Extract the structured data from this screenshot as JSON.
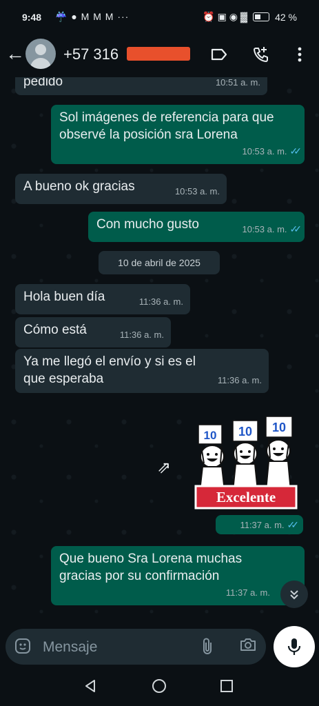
{
  "status": {
    "time": "9:48",
    "notifications": "☔ ● M M M ···",
    "icons": "⏰ ▣ ◉ ▓",
    "battery": "42 %"
  },
  "header": {
    "title": "+57 316",
    "back_icon": "←"
  },
  "messages": [
    {
      "dir": "in",
      "text": "pedido",
      "time": "10:51 a. m."
    },
    {
      "dir": "out",
      "text": "Sol imágenes de referencia para que observé la posición sra Lorena",
      "time": "10:53 a. m."
    },
    {
      "dir": "in",
      "text": "A bueno ok gracias",
      "time": "10:53 a. m."
    },
    {
      "dir": "out",
      "text": "Con mucho gusto",
      "time": "10:53 a. m."
    },
    {
      "dir": "in",
      "text": "Hola buen día",
      "time": "11:36 a. m."
    },
    {
      "dir": "in",
      "text": "Cómo está",
      "time": "11:36 a. m."
    },
    {
      "dir": "in",
      "text": "Ya me llegó el envío y si es el que esperaba",
      "time": "11:36 a. m."
    },
    {
      "dir": "out",
      "text": "Que bueno Sra Lorena muchas gracias por su confirmación",
      "time": "11:37 a. m."
    }
  ],
  "date_chip": "10 de abril de 2025",
  "sticker": {
    "numbers": [
      "10",
      "10",
      "10"
    ],
    "banner": "Excelente",
    "time": "11:37 a. m."
  },
  "input": {
    "placeholder": "Mensaje"
  },
  "colors": {
    "incoming": "#1f2c33",
    "outgoing": "#005c4b",
    "read_ticks": "#53bdeb",
    "background": "#0b1014"
  }
}
